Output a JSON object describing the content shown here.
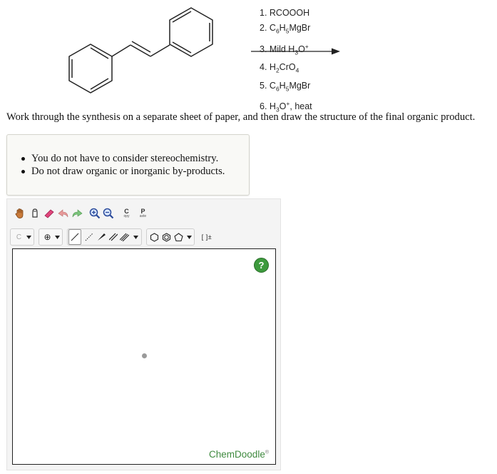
{
  "reaction": {
    "reagents": [
      {
        "num": "1.",
        "parts": [
          {
            "t": "RCOOOH"
          }
        ]
      },
      {
        "num": "2.",
        "parts": [
          {
            "t": "C"
          },
          {
            "sub": "6"
          },
          {
            "t": "H"
          },
          {
            "sub": "5"
          },
          {
            "t": "MgBr"
          }
        ]
      },
      {
        "num": "3.",
        "parts": [
          {
            "t": "Mild H"
          },
          {
            "sub": "3"
          },
          {
            "t": "O"
          },
          {
            "sup": "+"
          }
        ]
      },
      {
        "num": "4.",
        "parts": [
          {
            "t": "H"
          },
          {
            "sub": "2"
          },
          {
            "t": "CrO"
          },
          {
            "sub": "4"
          }
        ]
      },
      {
        "num": "5.",
        "parts": [
          {
            "t": "C"
          },
          {
            "sub": "6"
          },
          {
            "t": "H"
          },
          {
            "sub": "5"
          },
          {
            "t": "MgBr"
          }
        ]
      },
      {
        "num": "6.",
        "parts": [
          {
            "t": "H"
          },
          {
            "sub": "3"
          },
          {
            "t": "O"
          },
          {
            "sup": "+"
          },
          {
            "t": ", heat"
          }
        ]
      }
    ]
  },
  "instructions": "Work through the synthesis on a separate sheet of paper, and then draw the structure of the final organic product.",
  "notes": [
    "You do not have to consider stereochemistry.",
    "Do not draw organic or inorganic by-products."
  ],
  "toolbar": {
    "row1": [
      {
        "name": "hand-icon"
      },
      {
        "name": "lasso-icon"
      },
      {
        "name": "eraser-icon"
      },
      {
        "name": "undo-icon"
      },
      {
        "name": "redo-icon"
      },
      {
        "name": "zoom-in-icon"
      },
      {
        "name": "zoom-out-icon"
      },
      {
        "name": "copy-icon",
        "label_main": "C",
        "label_sub": "opy"
      },
      {
        "name": "paste-icon",
        "label_main": "P",
        "label_sub": "aste"
      }
    ],
    "atom_label": "C",
    "charge_label": "⊕",
    "bracket_label": "[ ]±"
  },
  "canvas": {
    "help_label": "?",
    "brand": "ChemDoodle",
    "brand_mark": "®"
  },
  "colors": {
    "help": "#3d9a3d",
    "brand": "#3f8a3f",
    "eraser": "#e0457b",
    "undo": "#e89a9a",
    "redo": "#7cc47c"
  }
}
